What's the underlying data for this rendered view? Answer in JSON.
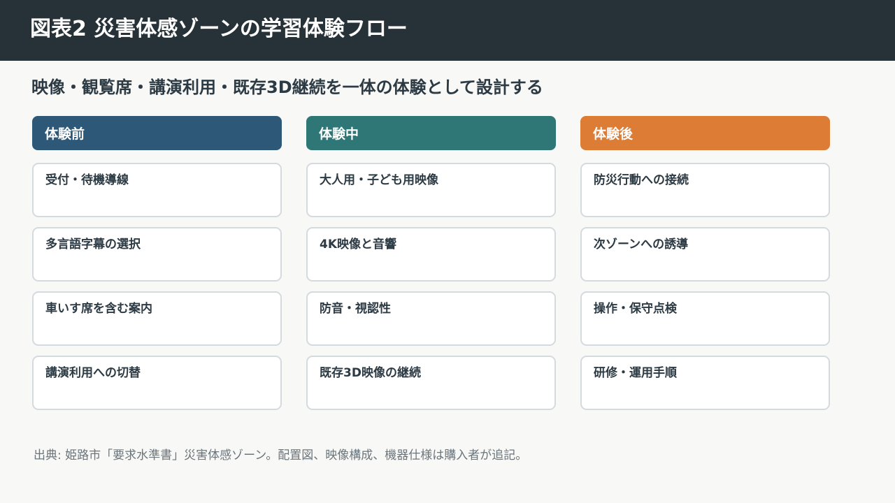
{
  "header": {
    "title": "図表2 災害体感ゾーンの学習体験フロー"
  },
  "subtitle": "映像・観覧席・講演利用・既存3D継続を一体の体験として設計する",
  "columns": [
    {
      "label": "体験前",
      "color": "#2e5878",
      "items": [
        "受付・待機導線",
        "多言語字幕の選択",
        "車いす席を含む案内",
        "講演利用への切替"
      ]
    },
    {
      "label": "体験中",
      "color": "#2f7677",
      "items": [
        "大人用・子ども用映像",
        "4K映像と音響",
        "防音・視認性",
        "既存3D映像の継続"
      ]
    },
    {
      "label": "体験後",
      "color": "#dc7c35",
      "items": [
        "防災行動への接続",
        "次ゾーンへの誘導",
        "操作・保守点検",
        "研修・運用手順"
      ]
    }
  ],
  "footnote": "出典: 姫路市「要求水準書」災害体感ゾーン。配置図、映像構成、機器仕様は購入者が追記。"
}
